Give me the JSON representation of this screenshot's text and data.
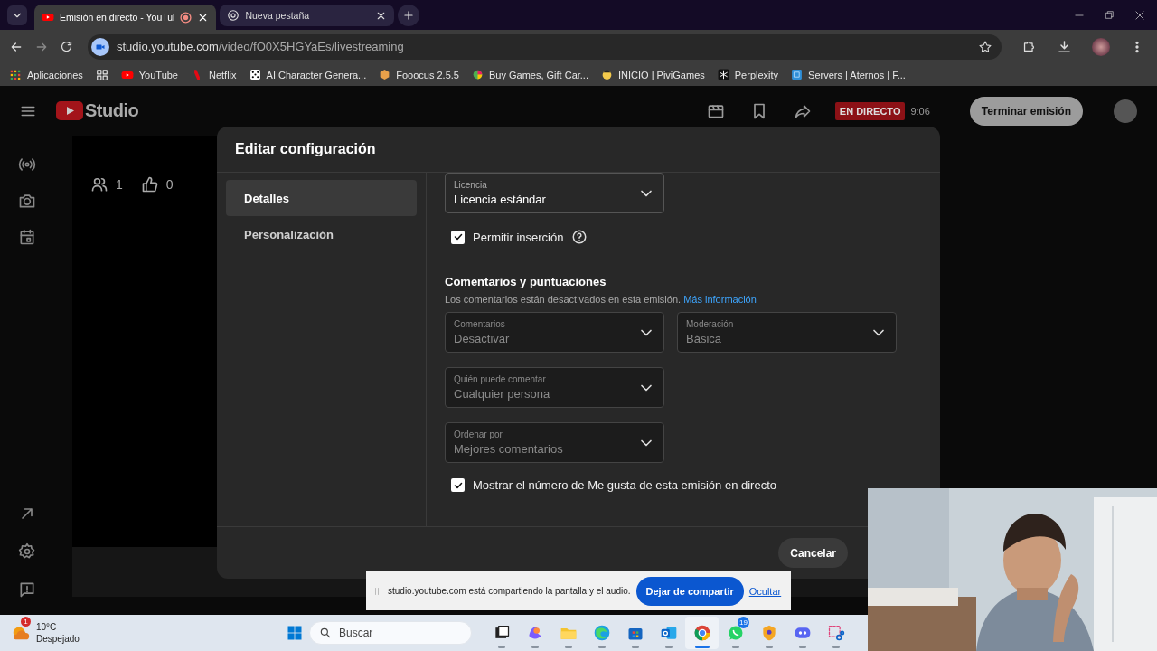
{
  "browser": {
    "tabs": [
      {
        "title": "Emisión en directo - YouTul",
        "selected": true,
        "recording": true
      },
      {
        "title": "Nueva pestaña",
        "selected": false,
        "recording": false
      }
    ],
    "address": {
      "host": "studio.youtube.com",
      "path": "/video/fO0X5HGYaEs/livestreaming"
    },
    "bookmarks": [
      {
        "kind": "apps",
        "label": "Aplicaciones"
      },
      {
        "kind": "youtube",
        "label": "YouTube"
      },
      {
        "kind": "netflix",
        "label": "Netflix"
      },
      {
        "kind": "dice",
        "label": "AI Character Genera..."
      },
      {
        "kind": "fooocus",
        "label": "Fooocus 2.5.5"
      },
      {
        "kind": "games",
        "label": "Buy Games, Gift Car..."
      },
      {
        "kind": "pivi",
        "label": "INICIO | PiviGames"
      },
      {
        "kind": "perplexity",
        "label": "Perplexity"
      },
      {
        "kind": "aternos",
        "label": "Servers | Aternos | F..."
      }
    ]
  },
  "studio": {
    "logo": "Studio",
    "live_badge": "EN DIRECTO",
    "live_time": "9:06",
    "end_button": "Terminar emisión",
    "viewers": "1",
    "likes": "0"
  },
  "dialog": {
    "title": "Editar configuración",
    "nav": [
      {
        "label": "Detalles",
        "selected": true
      },
      {
        "label": "Personalización",
        "selected": false
      }
    ],
    "license": {
      "label": "Licencia",
      "value": "Licencia estándar",
      "disabled": false
    },
    "embed": {
      "label": "Permitir inserción",
      "checked": true
    },
    "comments_section": {
      "title": "Comentarios y puntuaciones",
      "description": "Los comentarios están desactivados en esta emisión.",
      "link": "Más información"
    },
    "fields": [
      {
        "label": "Comentarios",
        "value": "Desactivar",
        "disabled": true
      },
      {
        "label": "Moderación",
        "value": "Básica",
        "disabled": true
      },
      {
        "label": "Quién puede comentar",
        "value": "Cualquier persona",
        "disabled": true
      },
      {
        "label": "Ordenar por",
        "value": "Mejores comentarios",
        "disabled": true
      }
    ],
    "show_likes": {
      "label": "Mostrar el número de Me gusta de esta emisión en directo",
      "checked": true
    },
    "cancel_button": "Cancelar"
  },
  "share_bar": {
    "message": "studio.youtube.com está compartiendo la pantalla y el audio.",
    "stop_button": "Dejar de compartir",
    "hide_link": "Ocultar"
  },
  "taskbar": {
    "weather": {
      "temperature": "10°C",
      "condition": "Despejado",
      "badge": "1"
    },
    "search": {
      "placeholder": "Buscar"
    },
    "apps": [
      {
        "kind": "taskview",
        "selected": false
      },
      {
        "kind": "copilot",
        "selected": false
      },
      {
        "kind": "files",
        "selected": false
      },
      {
        "kind": "edge",
        "selected": false
      },
      {
        "kind": "store",
        "selected": false
      },
      {
        "kind": "outlook",
        "selected": false
      },
      {
        "kind": "chrome",
        "selected": true
      },
      {
        "kind": "whatsapp",
        "selected": false,
        "badge": "19"
      },
      {
        "kind": "vpn",
        "selected": false
      },
      {
        "kind": "discord",
        "selected": false
      },
      {
        "kind": "snip",
        "selected": false
      }
    ]
  }
}
